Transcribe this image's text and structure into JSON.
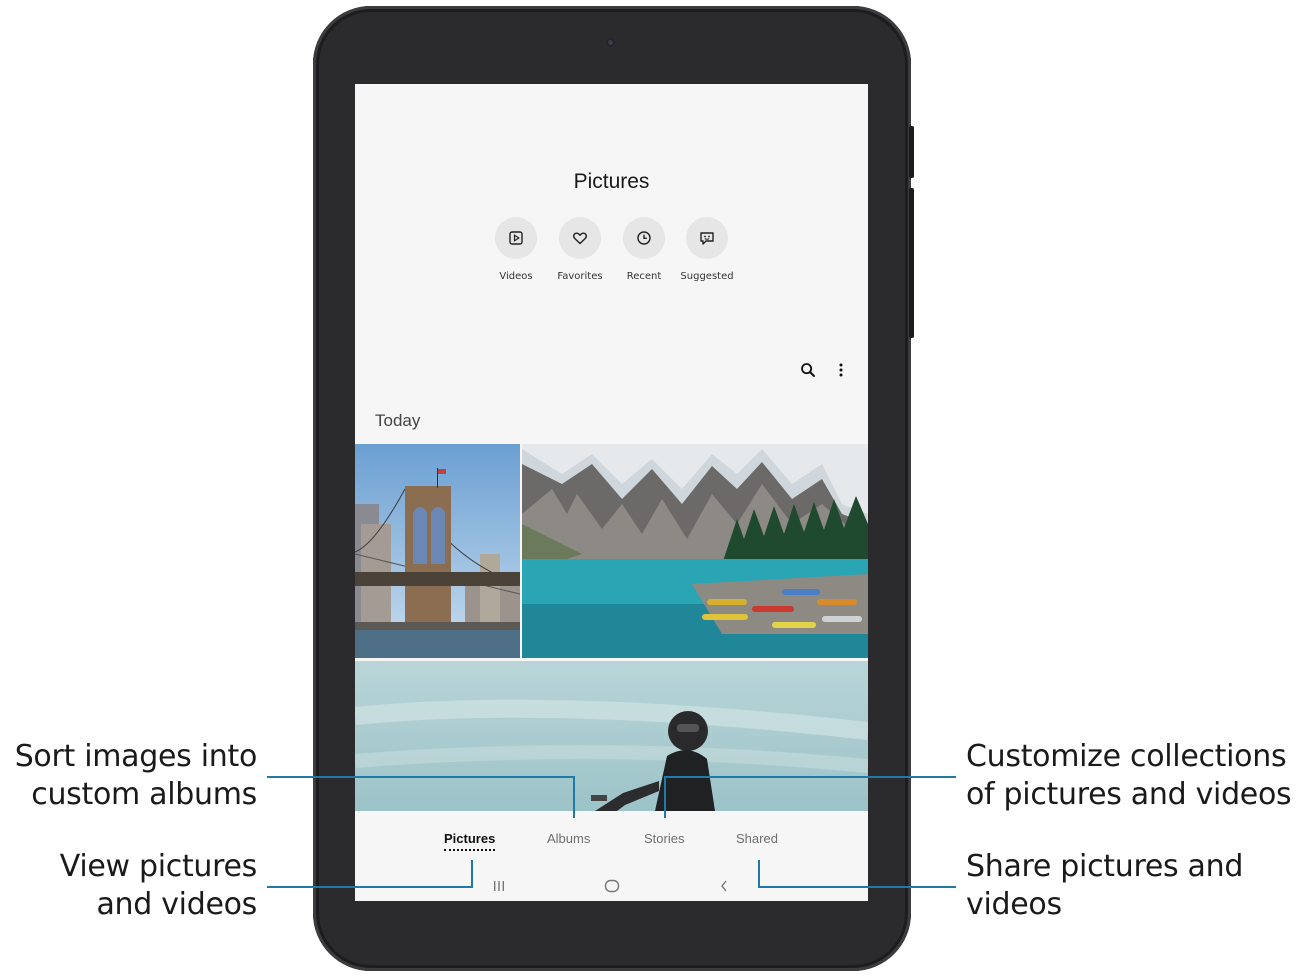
{
  "app": {
    "title": "Pictures",
    "quick_filters": [
      {
        "label": "Videos",
        "icon": "play-square-icon"
      },
      {
        "label": "Favorites",
        "icon": "heart-icon"
      },
      {
        "label": "Recent",
        "icon": "clock-icon"
      },
      {
        "label": "Suggested",
        "icon": "suggestion-bubble-icon"
      }
    ],
    "toolbar": {
      "search_icon": "search-icon",
      "more_icon": "more-vertical-icon"
    },
    "section_label": "Today",
    "photos": [
      {
        "subject": "bridge",
        "icon": "photo-thumbnail"
      },
      {
        "subject": "mountain-lake",
        "icon": "photo-thumbnail"
      },
      {
        "subject": "motorcyclist",
        "icon": "photo-thumbnail"
      }
    ],
    "bottom_tabs": [
      {
        "label": "Pictures",
        "active": true
      },
      {
        "label": "Albums",
        "active": false
      },
      {
        "label": "Stories",
        "active": false
      },
      {
        "label": "Shared",
        "active": false
      }
    ],
    "nav_keys": [
      "recents-icon",
      "home-icon",
      "back-icon"
    ]
  },
  "callouts": {
    "albums": {
      "line1": "Sort images into",
      "line2": "custom albums"
    },
    "pictures": {
      "line1": "View pictures",
      "line2": "and videos"
    },
    "stories": {
      "line1": "Customize collections",
      "line2": "of pictures and videos"
    },
    "shared": {
      "line1": "Share pictures and",
      "line2": "videos"
    }
  },
  "colors": {
    "callout_line": "#1f7aa8",
    "device_frame": "#2b2b2d",
    "screen_bg": "#f6f6f6"
  }
}
